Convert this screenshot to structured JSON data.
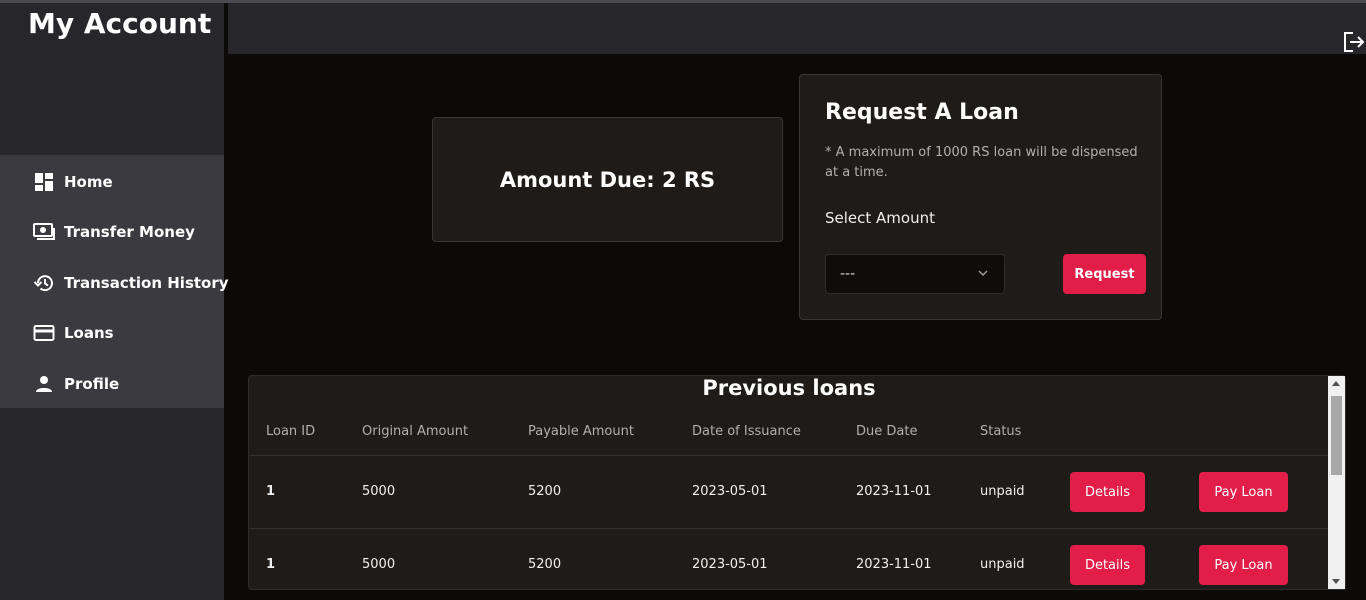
{
  "sidebar": {
    "title": "My Account",
    "items": [
      {
        "label": "Home",
        "icon": "dashboard-icon"
      },
      {
        "label": "Transfer Money",
        "icon": "money-icon"
      },
      {
        "label": "Transaction History",
        "icon": "history-icon"
      },
      {
        "label": "Loans",
        "icon": "credit-card-icon"
      },
      {
        "label": "Profile",
        "icon": "person-icon"
      }
    ]
  },
  "header": {
    "logout_icon": "logout-icon"
  },
  "amount_due": {
    "text": "Amount Due: 2 RS"
  },
  "request_loan": {
    "title": "Request A Loan",
    "note": "* A maximum of 1000 RS loan will be dispensed at a time.",
    "select_label": "Select Amount",
    "select_value": "---",
    "button_label": "Request"
  },
  "previous_loans": {
    "title": "Previous loans",
    "columns": [
      "Loan ID",
      "Original Amount",
      "Payable Amount",
      "Date of Issuance",
      "Due Date",
      "Status"
    ],
    "rows": [
      {
        "id": "1",
        "original": "5000",
        "payable": "5200",
        "issued": "2023-05-01",
        "due": "2023-11-01",
        "status": "unpaid",
        "details_label": "Details",
        "pay_label": "Pay Loan"
      },
      {
        "id": "1",
        "original": "5000",
        "payable": "5200",
        "issued": "2023-05-01",
        "due": "2023-11-01",
        "status": "unpaid",
        "details_label": "Details",
        "pay_label": "Pay Loan"
      }
    ]
  },
  "colors": {
    "accent": "#e11d48",
    "sidebar": "#27272b",
    "nav": "#3a3a40",
    "card": "#1e1b19",
    "background": "#0b0a09"
  }
}
